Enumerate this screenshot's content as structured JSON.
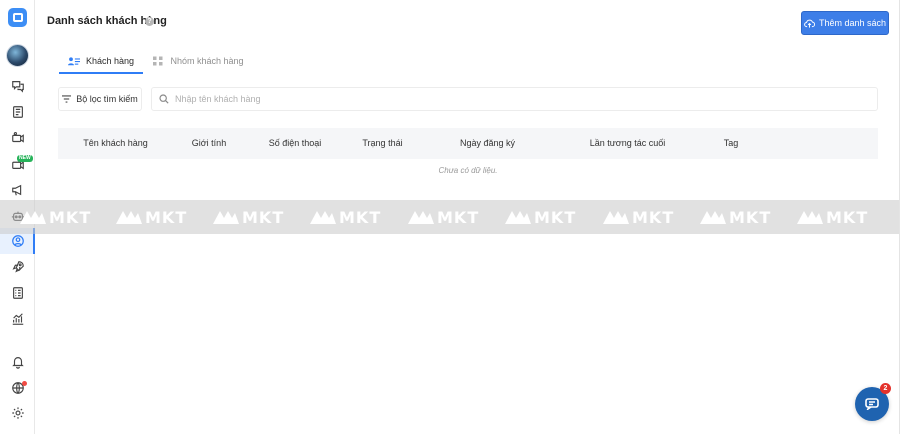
{
  "page": {
    "title": "Danh sách khách hàng",
    "help_symbol": "?",
    "add_button_label": "Thêm danh sách"
  },
  "tabs": [
    {
      "label": "Khách hàng",
      "active": true
    },
    {
      "label": "Nhóm khách hàng",
      "active": false
    }
  ],
  "filter": {
    "button_label": "Bộ lọc tìm kiếm",
    "search_placeholder": "Nhập tên khách hàng",
    "search_value": ""
  },
  "table": {
    "columns": [
      "Tên khách hàng",
      "Giới tính",
      "Số điện thoại",
      "Trạng thái",
      "Ngày đăng ký",
      "Lần tương tác cuối",
      "Tag"
    ],
    "rows": [],
    "empty_text": "Chưa có dữ liệu."
  },
  "sidebar": {
    "items": [
      {
        "icon": "chat-bubbles-icon"
      },
      {
        "icon": "document-list-icon"
      },
      {
        "icon": "video-camera-icon"
      },
      {
        "icon": "video-camera-new-icon",
        "badge": "NEW"
      },
      {
        "icon": "megaphone-icon"
      },
      {
        "icon": "robot-icon"
      },
      {
        "icon": "user-circle-icon",
        "active": true
      },
      {
        "icon": "rocket-icon"
      },
      {
        "icon": "form-list-icon"
      },
      {
        "icon": "chart-growth-icon"
      },
      {
        "icon": "bell-icon"
      },
      {
        "icon": "globe-icon",
        "dot": true
      },
      {
        "icon": "gear-icon"
      }
    ]
  },
  "watermark": {
    "text": "MKT"
  },
  "chat": {
    "badge_count": "2"
  },
  "colors": {
    "accent": "#2f7df6",
    "button": "#3d7ee8",
    "chat": "#1f63b0",
    "badge_red": "#e4322b",
    "new_badge": "#27b35a"
  }
}
